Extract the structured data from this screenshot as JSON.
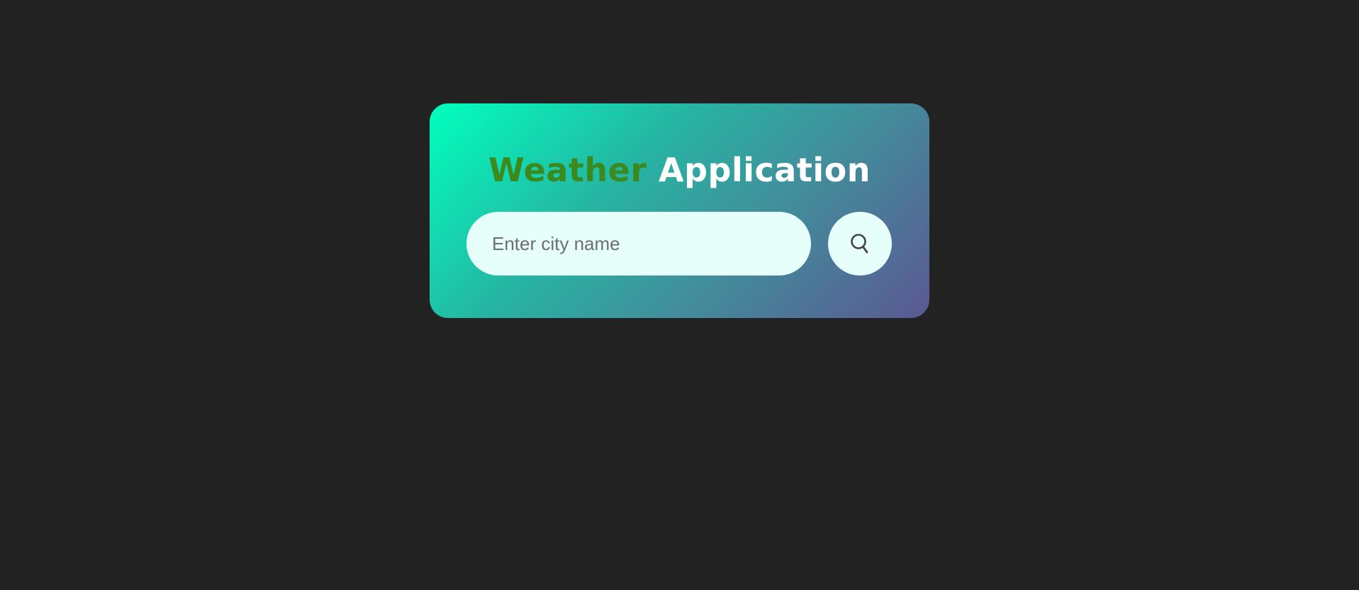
{
  "header": {
    "title_word_1": "Weather",
    "title_word_2": "Application"
  },
  "search": {
    "placeholder": "Enter city name",
    "value": "",
    "button_icon": "search-icon"
  },
  "colors": {
    "background": "#222222",
    "title_accent": "#3b8a1f",
    "title_primary": "#ffffff",
    "gradient_start": "#00ffbd",
    "gradient_end": "#5a5892",
    "field_background": "#e7fffb"
  }
}
